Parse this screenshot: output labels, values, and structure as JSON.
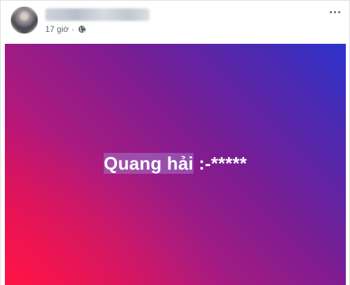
{
  "post": {
    "author_name": "",
    "time": "17 giờ",
    "separator": "·",
    "privacy_icon": "globe-icon",
    "more_icon": "more-options-icon",
    "text_highlighted": "Quang hải",
    "text_rest": " :-*****"
  },
  "colors": {
    "gradient_start": "#ff0844",
    "gradient_mid": "#7b1d93",
    "gradient_end": "#2d33cf",
    "meta_text": "#616770"
  }
}
